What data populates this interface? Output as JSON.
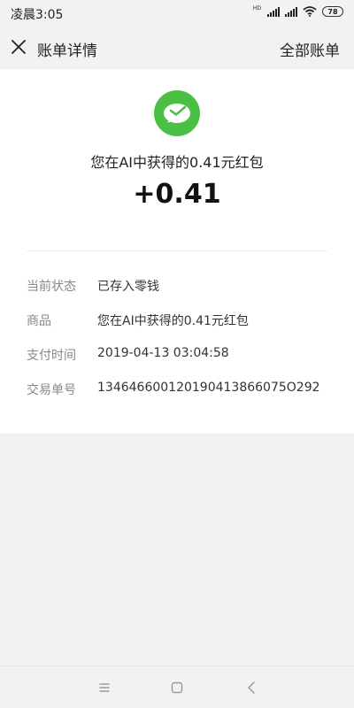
{
  "status_bar": {
    "time": "凌晨3:05",
    "hd": "HD",
    "battery": "78"
  },
  "header": {
    "title": "账单详情",
    "right_link": "全部账单"
  },
  "transaction": {
    "description": "您在AI中获得的0.41元红包",
    "amount": "+0.41",
    "details": [
      {
        "label": "当前状态",
        "value": "已存入零钱"
      },
      {
        "label": "商品",
        "value": "您在AI中获得的0.41元红包"
      },
      {
        "label": "支付时间",
        "value": "2019-04-13 03:04:58"
      },
      {
        "label": "交易单号",
        "value": "134646600120190413866075O292"
      }
    ]
  },
  "icons": {
    "close": "close-icon",
    "logo": "wechat-pay-logo-icon",
    "menu": "menu-icon",
    "home": "home-icon",
    "back": "back-icon"
  },
  "colors": {
    "accent": "#4cbf45",
    "background": "#f2f2f2",
    "card": "#ffffff",
    "label": "#888888"
  }
}
